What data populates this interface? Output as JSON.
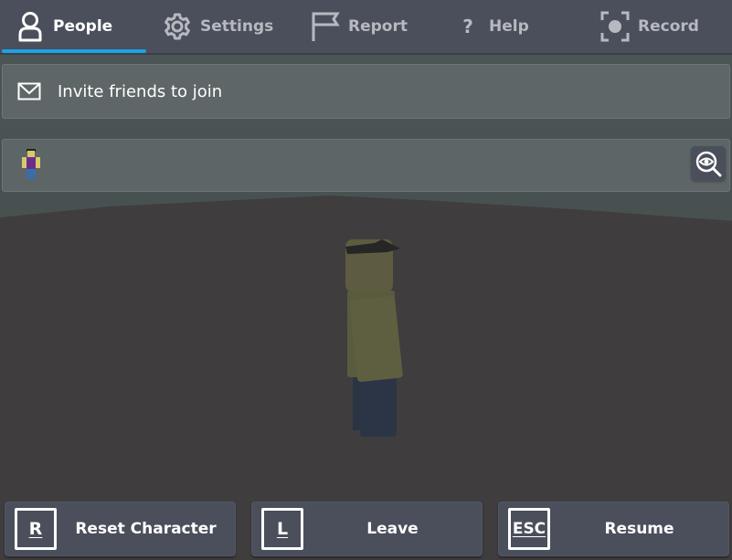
{
  "tabs": [
    {
      "id": "people",
      "label": "People",
      "icon": "person-icon",
      "active": true
    },
    {
      "id": "settings",
      "label": "Settings",
      "icon": "gear-icon",
      "active": false
    },
    {
      "id": "report",
      "label": "Report",
      "icon": "flag-icon",
      "active": false
    },
    {
      "id": "help",
      "label": "Help",
      "icon": "question-icon",
      "active": false
    },
    {
      "id": "record",
      "label": "Record",
      "icon": "record-icon",
      "active": false
    }
  ],
  "invite": {
    "label": "Invite friends to join",
    "icon": "mail-icon"
  },
  "players": [
    {
      "avatar": "player-avatar",
      "name": "",
      "action_icon": "inspect-icon"
    }
  ],
  "buttons": [
    {
      "key": "R",
      "label": "Reset Character"
    },
    {
      "key": "L",
      "label": "Leave"
    },
    {
      "key": "ESC",
      "label": "Resume"
    }
  ],
  "colors": {
    "accent": "#1aa2e6",
    "tabbar_bg": "#4a4f5b",
    "button_bg": "#4a4f5b",
    "inactive_text": "#b6b9c0",
    "active_text": "#ffffff"
  }
}
